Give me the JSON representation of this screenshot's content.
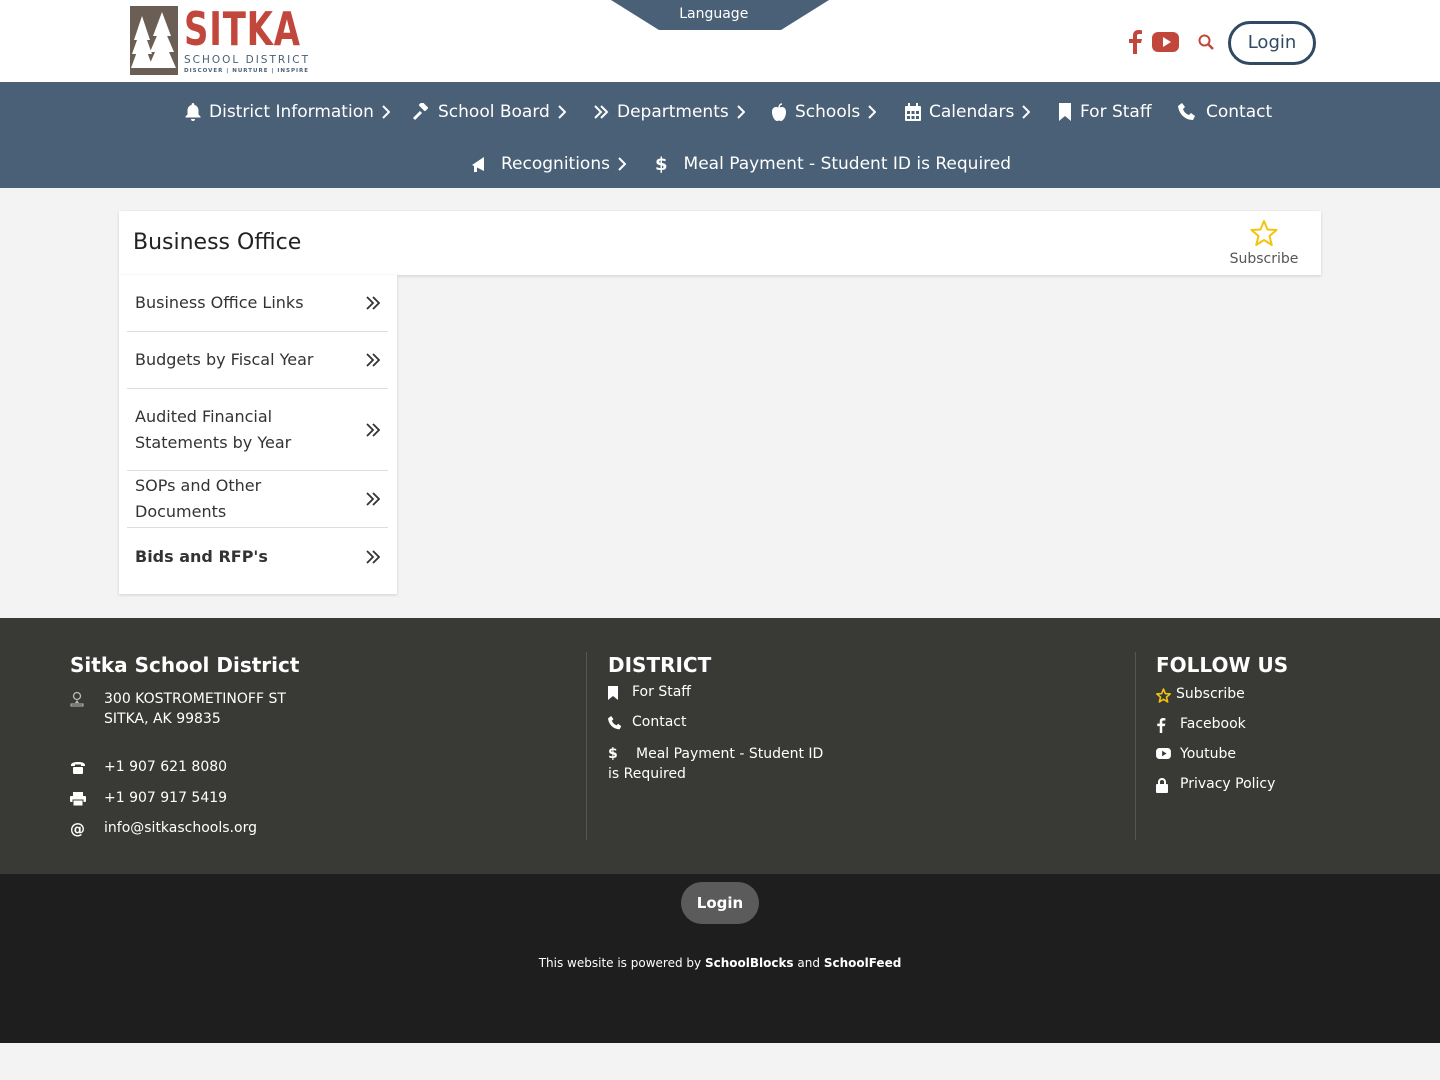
{
  "header": {
    "logo": {
      "name": "SITKA",
      "sub": "SCHOOL DISTRICT",
      "tagline": "DISCOVER | NURTURE | INSPIRE"
    },
    "language_label": "Language",
    "login_label": "Login",
    "colors": {
      "brand_red": "#c1473c",
      "nav_blue": "#4a6076",
      "login_border": "#2f4a62"
    }
  },
  "nav": {
    "items": [
      {
        "label": "District Information",
        "icon": "bell-icon",
        "has_submenu": true
      },
      {
        "label": "School Board",
        "icon": "gavel-icon",
        "has_submenu": true
      },
      {
        "label": "Departments",
        "icon": "double-chevron-icon",
        "has_submenu": true
      },
      {
        "label": "Schools",
        "icon": "apple-icon",
        "has_submenu": true
      },
      {
        "label": "Calendars",
        "icon": "calendar-icon",
        "has_submenu": true
      },
      {
        "label": "For Staff",
        "icon": "bookmark-icon",
        "has_submenu": false
      },
      {
        "label": "Contact",
        "icon": "phone-icon",
        "has_submenu": false
      },
      {
        "label": "Recognitions",
        "icon": "bullhorn-icon",
        "has_submenu": true
      },
      {
        "label": "Meal Payment - Student ID is Required",
        "icon": "dollar-icon",
        "has_submenu": false
      }
    ]
  },
  "page": {
    "title": "Business Office",
    "subscribe_label": "Subscribe",
    "sidebar": [
      {
        "label": "Business Office Links",
        "active": false
      },
      {
        "label": "Budgets by Fiscal Year",
        "active": false
      },
      {
        "label": "Audited Financial Statements by Year",
        "active": false
      },
      {
        "label": "SOPs and Other Documents",
        "active": false
      },
      {
        "label": "Bids and RFP's",
        "active": true
      }
    ]
  },
  "footer": {
    "org": {
      "title": "Sitka School District",
      "address_line1": "300 KOSTROMETINOFF ST",
      "address_line2": "SITKA, AK 99835",
      "phone": "+1 907 621 8080",
      "fax": "+1 907 917 5419",
      "email": "info@sitkaschools.org"
    },
    "district": {
      "title": "DISTRICT",
      "links": [
        "For Staff",
        "Contact",
        "Meal Payment - Student ID",
        "is Required"
      ]
    },
    "follow": {
      "title": "FOLLOW US",
      "links": [
        "Subscribe",
        "Facebook",
        "Youtube",
        "Privacy Policy"
      ]
    }
  },
  "bottom": {
    "login_label": "Login",
    "powered_prefix": "This website is powered by",
    "powered_brand1": "SchoolBlocks",
    "powered_and": "and",
    "powered_brand2": "SchoolFeed"
  }
}
